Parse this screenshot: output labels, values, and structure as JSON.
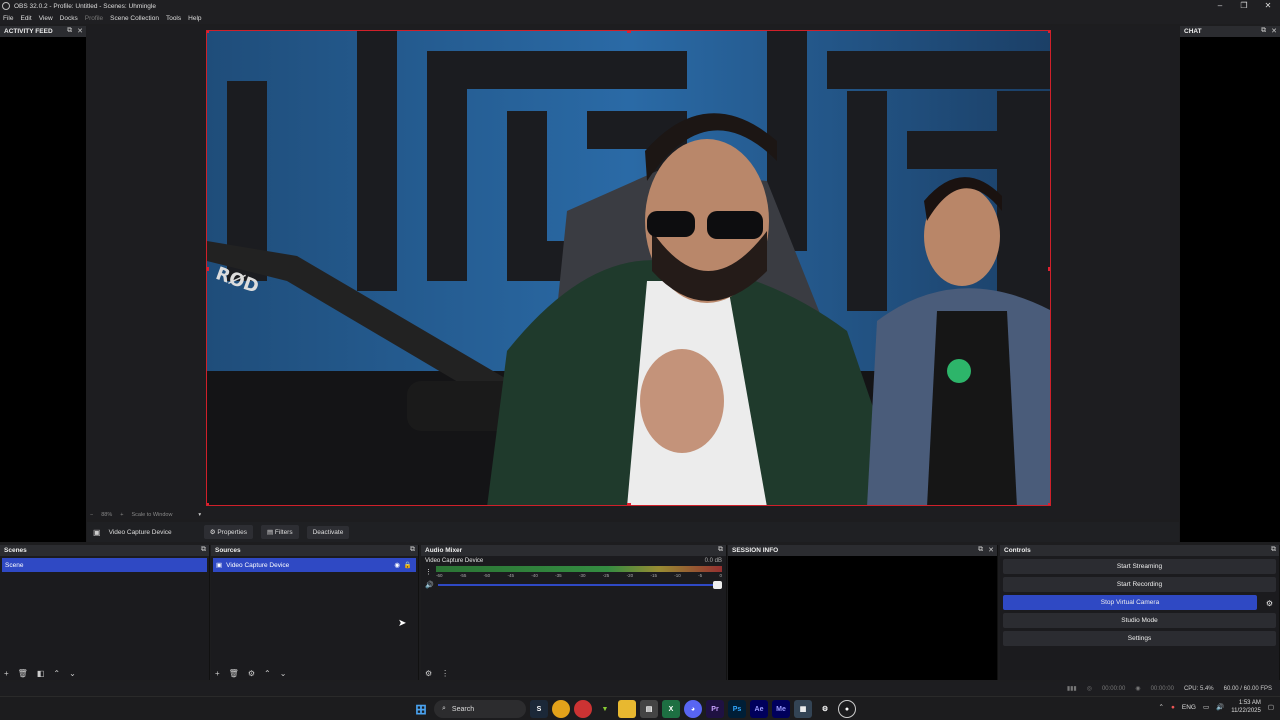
{
  "window": {
    "title": "OBS 32.0.2 - Profile: Untitled - Scenes: Uhmingle",
    "min": "–",
    "max": "❐",
    "close": "✕"
  },
  "menu": [
    "File",
    "Edit",
    "View",
    "Docks",
    "Profile",
    "Scene Collection",
    "Tools",
    "Help"
  ],
  "docks": {
    "activity": "ACTIVITY FEED",
    "chat": "CHAT",
    "session": "SESSION INFO"
  },
  "zoom": {
    "minus": "−",
    "value": "88%",
    "plus": "+",
    "scale_label": "Scale to Window",
    "chev": "▾"
  },
  "source_toolbar": {
    "source": "Video Capture Device",
    "properties": "Properties",
    "filters": "Filters",
    "deactivate": "Deactivate"
  },
  "scenes": {
    "title": "Scenes",
    "items": [
      "Scene"
    ]
  },
  "sources": {
    "title": "Sources",
    "items": [
      "Video Capture Device"
    ]
  },
  "mixer": {
    "title": "Audio Mixer",
    "channel": "Video Capture Device",
    "db": "0.0 dB",
    "ticks": [
      "-60",
      "-55",
      "-50",
      "-45",
      "-40",
      "-35",
      "-30",
      "-25",
      "-20",
      "-15",
      "-10",
      "-5",
      "0"
    ],
    "volume": 1.0
  },
  "controls": {
    "title": "Controls",
    "start_streaming": "Start Streaming",
    "start_recording": "Start Recording",
    "stop_virtual_camera": "Stop Virtual Camera",
    "studio_mode": "Studio Mode",
    "settings": "Settings"
  },
  "status": {
    "stream_time": "00:00:00",
    "rec_time": "00:00:00",
    "cpu": "CPU: 5.4%",
    "fps": "60.00 / 60.00 FPS"
  },
  "taskbar": {
    "search": "Search",
    "lang": "ENG",
    "time": "1:53 AM",
    "date": "11/22/2025",
    "apps": [
      "Ps",
      "Ae",
      "Me",
      "Pr"
    ]
  },
  "colors": {
    "accent": "#2f49c4",
    "selection_border": "#d0202a"
  }
}
